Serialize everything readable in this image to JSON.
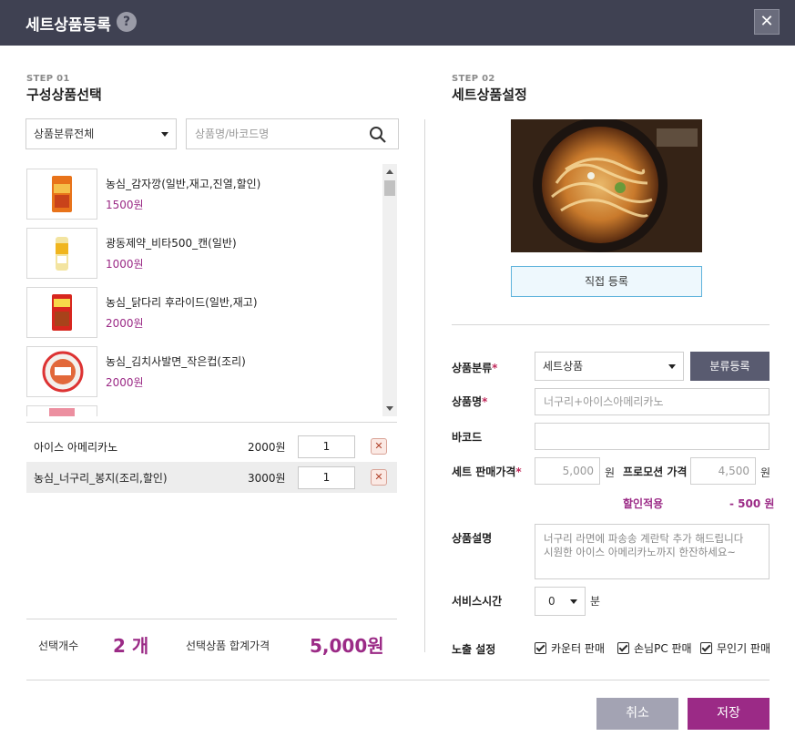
{
  "dialog": {
    "title": "세트상품등록",
    "help": "?",
    "close": "✕"
  },
  "step1": {
    "label": "STEP 01",
    "title": "구성상품선택",
    "category_select": "상품분류전체",
    "search_placeholder": "상품명/바코드명",
    "products": [
      {
        "name": "농심_감자깡(일반,재고,진열,할인)",
        "price": "1500원"
      },
      {
        "name": "광동제약_비타500_캔(일반)",
        "price": "1000원"
      },
      {
        "name": "농심_닭다리 후라이드(일반,재고)",
        "price": "2000원"
      },
      {
        "name": "농심_김치사발면_작은컵(조리)",
        "price": "2000원"
      }
    ],
    "selected": [
      {
        "name": "아이스 아메리카노",
        "price": "2000원",
        "qty": "1"
      },
      {
        "name": "농심_너구리_봉지(조리,할인)",
        "price": "3000원",
        "qty": "1"
      }
    ],
    "summary": {
      "count_label": "선택개수",
      "count_value": "2 개",
      "total_label": "선택상품 합계가격",
      "total_value": "5,000원"
    }
  },
  "step2": {
    "label": "STEP 02",
    "title": "세트상품설정",
    "direct_register": "직접 등록",
    "form": {
      "category_label": "상품분류",
      "category_value": "세트상품",
      "category_register_btn": "분류등록",
      "name_label": "상품명",
      "name_placeholder": "너구리+아이스아메리카노",
      "barcode_label": "바코드",
      "sale_price_label": "세트 판매가격",
      "sale_price_placeholder": "5,000",
      "won": "원",
      "promo_label": "프로모션 가격",
      "promo_placeholder": "4,500",
      "discount_label": "할인적용",
      "discount_value": "- 500 원",
      "desc_label": "상품설명",
      "desc_line1": "너구리 라면에 파송송 계란탁 추가 해드립니다",
      "desc_line2": "시원한 아이스 아메리카노까지 한잔하세요~",
      "service_label": "서비스시간",
      "service_value": "0",
      "service_unit": "분",
      "exposure_label": "노출 설정",
      "exposure_options": [
        "카운터 판매",
        "손님PC 판매",
        "무인기 판매"
      ]
    }
  },
  "footer": {
    "cancel": "취소",
    "save": "저장"
  },
  "colors": {
    "titlebar": "#3f4152",
    "accent": "#9b2a86",
    "save_button": "#9b2a86",
    "cancel_button": "#a3a3b3"
  }
}
